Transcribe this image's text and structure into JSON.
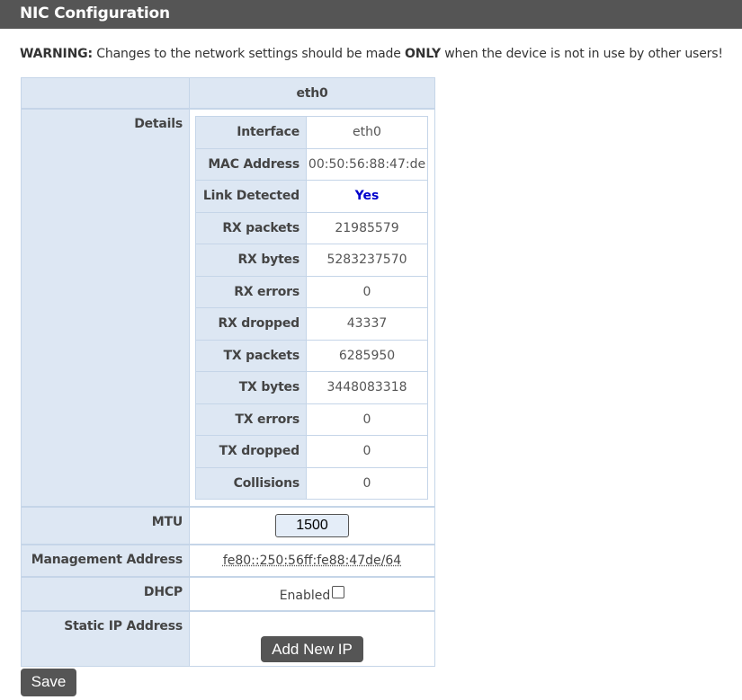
{
  "header": {
    "title": "NIC Configuration"
  },
  "warning": {
    "prefix": "WARNING:",
    "text1": " Changes to the network settings should be made ",
    "emphasis": "ONLY",
    "text2": " when the device is not in use by other users!"
  },
  "table": {
    "column_header": "eth0",
    "details_label": "Details",
    "details": [
      {
        "key": "Interface",
        "value": "eth0"
      },
      {
        "key": "MAC Address",
        "value": "00:50:56:88:47:de"
      },
      {
        "key": "Link Detected",
        "value": "Yes"
      },
      {
        "key": "RX packets",
        "value": "21985579"
      },
      {
        "key": "RX bytes",
        "value": "5283237570"
      },
      {
        "key": "RX errors",
        "value": "0"
      },
      {
        "key": "RX dropped",
        "value": "43337"
      },
      {
        "key": "TX packets",
        "value": "6285950"
      },
      {
        "key": "TX bytes",
        "value": "3448083318"
      },
      {
        "key": "TX errors",
        "value": "0"
      },
      {
        "key": "TX dropped",
        "value": "0"
      },
      {
        "key": "Collisions",
        "value": "0"
      }
    ],
    "mtu_label": "MTU",
    "mtu_value": "1500",
    "mgmt_label": "Management Address",
    "mgmt_value": "fe80::250:56ff:fe88:47de/64",
    "dhcp_label": "DHCP",
    "dhcp_value": "Enabled",
    "dhcp_checked": false,
    "static_label": "Static IP Address",
    "add_ip_button": "Add New IP"
  },
  "save_button": "Save",
  "colors": {
    "header_bg": "#555555",
    "label_bg": "#dde7f3",
    "border": "#c5d5e8",
    "link_yes": "#0000cc"
  }
}
